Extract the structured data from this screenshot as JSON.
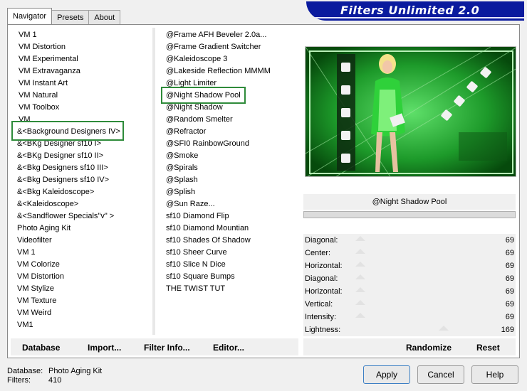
{
  "tabs": [
    "Navigator",
    "Presets",
    "About"
  ],
  "banner_title": "Filters Unlimited 2.0",
  "categories": [
    "VM 1",
    "VM Distortion",
    "VM Experimental",
    "VM Extravaganza",
    "VM Instant Art",
    "VM Natural",
    "VM Toolbox",
    "VM",
    "&<Background Designers IV>",
    "&<BKg Designer sf10 I>",
    "&<BKg Designer sf10 II>",
    "&<Bkg Designers sf10 III>",
    "&<Bkg Designers sf10 IV>",
    "&<Bkg Kaleidoscope>",
    "&<Kaleidoscope>",
    "&<Sandflower Specials\"v\" >",
    "Photo Aging Kit",
    "Videofilter",
    "VM 1",
    "VM Colorize",
    "VM Distortion",
    "VM Stylize",
    "VM Texture",
    "VM Weird",
    "VM1"
  ],
  "filters": [
    "@Frame AFH Beveler 2.0a...",
    "@Frame Gradient Switcher",
    "@Kaleidoscope 3",
    "@Lakeside Reflection MMMM",
    "@Light Limiter",
    "@Night Shadow Pool",
    "@Night Shadow",
    "@Random Smelter",
    "@Refractor",
    "@SFI0 RainbowGround",
    "@Smoke",
    "@Spirals",
    "@Splash",
    "@Splish",
    "@Sun Raze...",
    "sf10 Diamond Flip",
    "sf10 Diamond Mountian",
    "sf10 Shades Of Shadow",
    "sf10 Sheer Curve",
    "sf10 Slice N Dice",
    "sf10 Square Bumps",
    "THE TWIST TUT"
  ],
  "selected_filter": "@Night Shadow Pool",
  "params": [
    {
      "label": "Diagonal:",
      "value": "69",
      "level": 0.27
    },
    {
      "label": "Center:",
      "value": "69",
      "level": 0.27
    },
    {
      "label": "Horizontal:",
      "value": "69",
      "level": 0.27
    },
    {
      "label": "Diagonal:",
      "value": "69",
      "level": 0.27
    },
    {
      "label": "Horizontal:",
      "value": "69",
      "level": 0.27
    },
    {
      "label": "Vertical:",
      "value": "69",
      "level": 0.27
    },
    {
      "label": "Intensity:",
      "value": "69",
      "level": 0.27
    },
    {
      "label": "Lightness:",
      "value": "169",
      "level": 0.66
    }
  ],
  "buttons": {
    "database": "Database",
    "import": "Import...",
    "filter_info": "Filter Info...",
    "editor": "Editor...",
    "randomize": "Randomize",
    "reset": "Reset",
    "apply": "Apply",
    "cancel": "Cancel",
    "help": "Help"
  },
  "status": {
    "database_label": "Database:",
    "database_value": "Photo Aging Kit",
    "filters_label": "Filters:",
    "filters_value": "410"
  },
  "colors": {
    "banner": "#0a1a9e",
    "highlight": "#2e8b3a",
    "preview_green": "#0a5c12"
  }
}
